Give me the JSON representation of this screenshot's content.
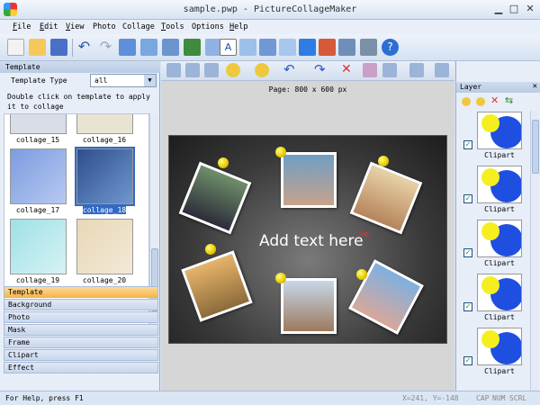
{
  "window": {
    "title": "sample.pwp - PictureCollageMaker"
  },
  "menu": [
    {
      "hot": "F",
      "rest": "ile"
    },
    {
      "hot": "E",
      "rest": "dit"
    },
    {
      "hot": "V",
      "rest": "iew"
    },
    {
      "hot": "",
      "rest": "Photo"
    },
    {
      "hot": "",
      "rest": "Collage"
    },
    {
      "hot": "T",
      "rest": "ools"
    },
    {
      "hot": "",
      "rest": "Options"
    },
    {
      "hot": "H",
      "rest": "elp"
    }
  ],
  "template_panel": {
    "header": "Template",
    "type_label": "Template Type",
    "type_value": "all",
    "hint": "Double click on template to apply it to collage",
    "thumbs": [
      "collage_15",
      "collage_16",
      "collage_17",
      "collage_18",
      "collage_19",
      "collage_20"
    ],
    "selected": "collage_18"
  },
  "categories": [
    "Template",
    "Background",
    "Photo",
    "Mask",
    "Frame",
    "Clipart",
    "Effect"
  ],
  "canvas": {
    "page_size": "Page: 800 x 600 px",
    "add_text": "Add text here"
  },
  "layer_panel": {
    "header": "Layer",
    "close": "✕",
    "layers": [
      "Clipart",
      "Clipart",
      "Clipart",
      "Clipart",
      "Clipart"
    ]
  },
  "status": {
    "help": "For Help, press F1",
    "coords": "X=241, Y=-148",
    "cap": "CAP",
    "num": "NUM",
    "scrl": "SCRL"
  },
  "colors": {
    "selection": "#316ac5",
    "active_category": "#f7b64a",
    "clipart_blue": "#1f4fe0",
    "clipart_yellow": "#f5ef20"
  }
}
